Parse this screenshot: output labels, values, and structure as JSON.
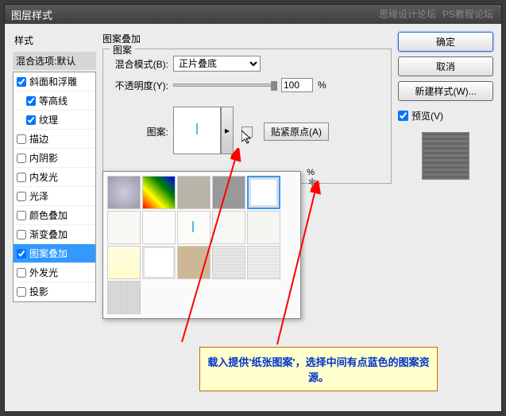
{
  "titlebar": "图层样式",
  "watermark": {
    "line1": "思缘设计论坛",
    "line2": "PS教程论坛"
  },
  "left": {
    "header": "样式",
    "sub": "混合选项:默认",
    "items": [
      {
        "label": "斜面和浮雕",
        "checked": true,
        "indent": 0
      },
      {
        "label": "等高线",
        "checked": true,
        "indent": 1
      },
      {
        "label": "纹理",
        "checked": true,
        "indent": 1
      },
      {
        "label": "描边",
        "checked": false,
        "indent": 0
      },
      {
        "label": "内阴影",
        "checked": false,
        "indent": 0
      },
      {
        "label": "内发光",
        "checked": false,
        "indent": 0
      },
      {
        "label": "光泽",
        "checked": false,
        "indent": 0
      },
      {
        "label": "颜色叠加",
        "checked": false,
        "indent": 0
      },
      {
        "label": "渐变叠加",
        "checked": false,
        "indent": 0
      },
      {
        "label": "图案叠加",
        "checked": true,
        "indent": 0,
        "selected": true
      },
      {
        "label": "外发光",
        "checked": false,
        "indent": 0
      },
      {
        "label": "投影",
        "checked": false,
        "indent": 0
      }
    ]
  },
  "middle": {
    "section_title": "图案叠加",
    "group_label": "图案",
    "blend_label": "混合模式(B):",
    "blend_value": "正片叠底",
    "opacity_label": "不透明度(Y):",
    "opacity_value": "100",
    "opacity_unit": "%",
    "pattern_label": "图案:",
    "snap_label": "贴紧原点(A)",
    "scale_unit": "%"
  },
  "right": {
    "ok": "确定",
    "cancel": "取消",
    "newstyle": "新建样式(W)...",
    "preview": "预览(V)"
  },
  "callout_text": "载入提供'纸张图案'，选择中间有点蓝色的图案资源。"
}
